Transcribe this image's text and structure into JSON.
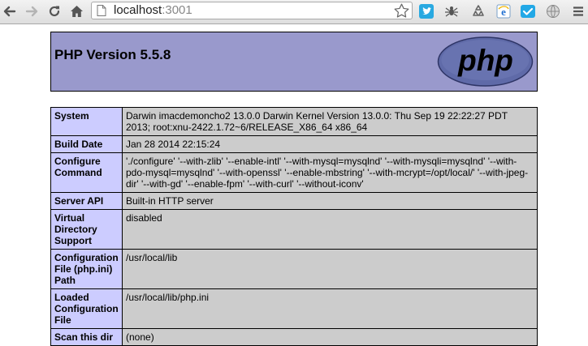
{
  "browser": {
    "url_host": "localhost",
    "url_port": ":3001"
  },
  "page": {
    "title": "PHP Version 5.5.8",
    "logo_text": "php",
    "colors": {
      "header_bg": "#9999cc",
      "key_bg": "#ccccff",
      "value_bg": "#cccccc"
    }
  },
  "rows": [
    {
      "key": "System",
      "value": "Darwin imacdemoncho2 13.0.0 Darwin Kernel Version 13.0.0: Thu Sep 19 22:22:27 PDT 2013; root:xnu-2422.1.72~6/RELEASE_X86_64 x86_64"
    },
    {
      "key": "Build Date",
      "value": "Jan 28 2014 22:15:24"
    },
    {
      "key": "Configure Command",
      "value": "'./configure' '--with-zlib' '--enable-intl' '--with-mysql=mysqlnd' '--with-mysqli=mysqlnd' '--with-pdo-mysql=mysqlnd' '--with-openssl' '--enable-mbstring' '--with-mcrypt=/opt/local/' '--with-jpeg-dir' '--with-gd' '--enable-fpm' '--with-curl' '--without-iconv'"
    },
    {
      "key": "Server API",
      "value": "Built-in HTTP server"
    },
    {
      "key": "Virtual Directory Support",
      "value": "disabled"
    },
    {
      "key": "Configuration File (php.ini) Path",
      "value": "/usr/local/lib"
    },
    {
      "key": "Loaded Configuration File",
      "value": "/usr/local/lib/php.ini"
    },
    {
      "key": "Scan this dir",
      "value": "(none)"
    }
  ]
}
